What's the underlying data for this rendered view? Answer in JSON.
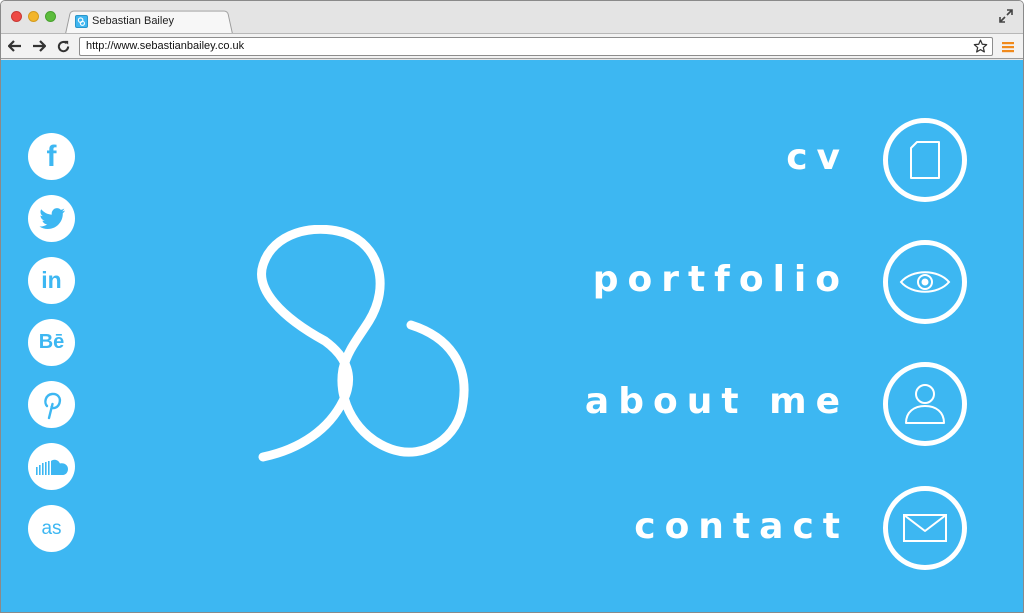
{
  "browser": {
    "tab_title": "Sebastian Bailey",
    "url": "http://www.sebastianbailey.co.uk"
  },
  "social_icons": [
    {
      "name": "facebook-icon",
      "glyph": "f"
    },
    {
      "name": "twitter-icon",
      "glyph": ""
    },
    {
      "name": "linkedin-icon",
      "glyph": "in"
    },
    {
      "name": "behance-icon",
      "glyph": "Bē"
    },
    {
      "name": "pinterest-icon",
      "glyph": "p"
    },
    {
      "name": "soundcloud-icon",
      "glyph": ""
    },
    {
      "name": "lastfm-icon",
      "glyph": "as"
    }
  ],
  "nav": {
    "cv": "cv",
    "portfolio": "portfolio",
    "about": "about me",
    "contact": "contact"
  },
  "colors": {
    "page_background": "#3db7f2",
    "foreground": "#ffffff"
  }
}
